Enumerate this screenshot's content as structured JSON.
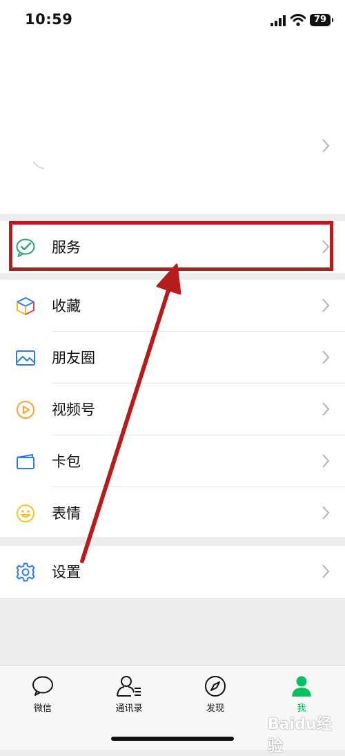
{
  "status_bar": {
    "time": "10:59",
    "battery": "79"
  },
  "menu_service": {
    "label": "服务",
    "icon": "service-check-bubble-icon"
  },
  "menu_items": [
    {
      "label": "收藏",
      "icon": "favorites-cube-icon"
    },
    {
      "label": "朋友圈",
      "icon": "moments-photo-icon"
    },
    {
      "label": "视频号",
      "icon": "channels-play-icon"
    },
    {
      "label": "卡包",
      "icon": "card-wallet-icon"
    },
    {
      "label": "表情",
      "icon": "sticker-smile-icon"
    }
  ],
  "menu_settings": {
    "label": "设置",
    "icon": "gear-icon"
  },
  "tabs": [
    {
      "label": "微信",
      "icon": "chat-bubble-icon"
    },
    {
      "label": "通讯录",
      "icon": "contacts-icon"
    },
    {
      "label": "发现",
      "icon": "compass-icon"
    },
    {
      "label": "我",
      "icon": "me-person-icon",
      "active": true
    }
  ],
  "watermark": "Baidu经验",
  "colors": {
    "accent": "#07c160",
    "annotation": "#b71c1c",
    "background": "#ededed"
  }
}
